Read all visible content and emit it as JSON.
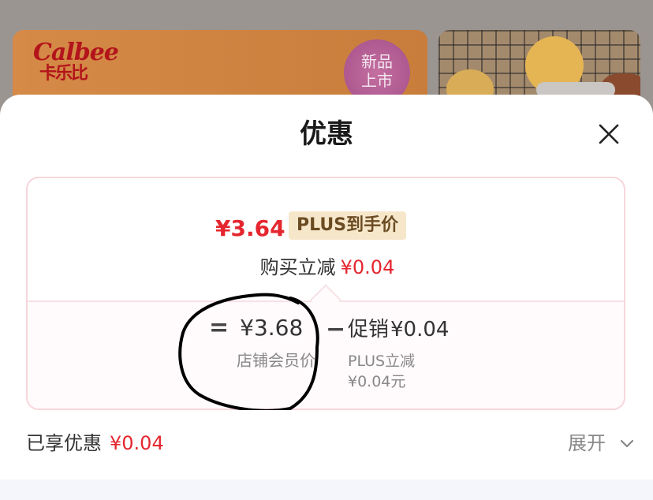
{
  "background": {
    "brand_logo": "Calbee",
    "brand_logo_cn": "卡乐比",
    "badge_text": "新品上市"
  },
  "sheet": {
    "title": "优惠",
    "close_icon": "close-icon"
  },
  "card": {
    "final_price": "¥3.64",
    "final_price_tag": "PLUS到手价",
    "reduce_label": "购买立减",
    "reduce_amount": "¥0.04",
    "equals": "=",
    "shop_price": "¥3.68",
    "shop_price_label": "店铺会员价",
    "minus": "−",
    "promo_label": "促销",
    "promo_amount": "¥0.04",
    "plus_reduce_label": "PLUS立减",
    "plus_reduce_amount": "¥0.04元"
  },
  "footer": {
    "enjoyed_label": "已享优惠",
    "enjoyed_amount": "¥0.04",
    "expand_label": "展开"
  },
  "colors": {
    "accent_red": "#e5262f",
    "card_border": "#f7d6dc",
    "plus_tag_bg": "#f6e7cb"
  }
}
